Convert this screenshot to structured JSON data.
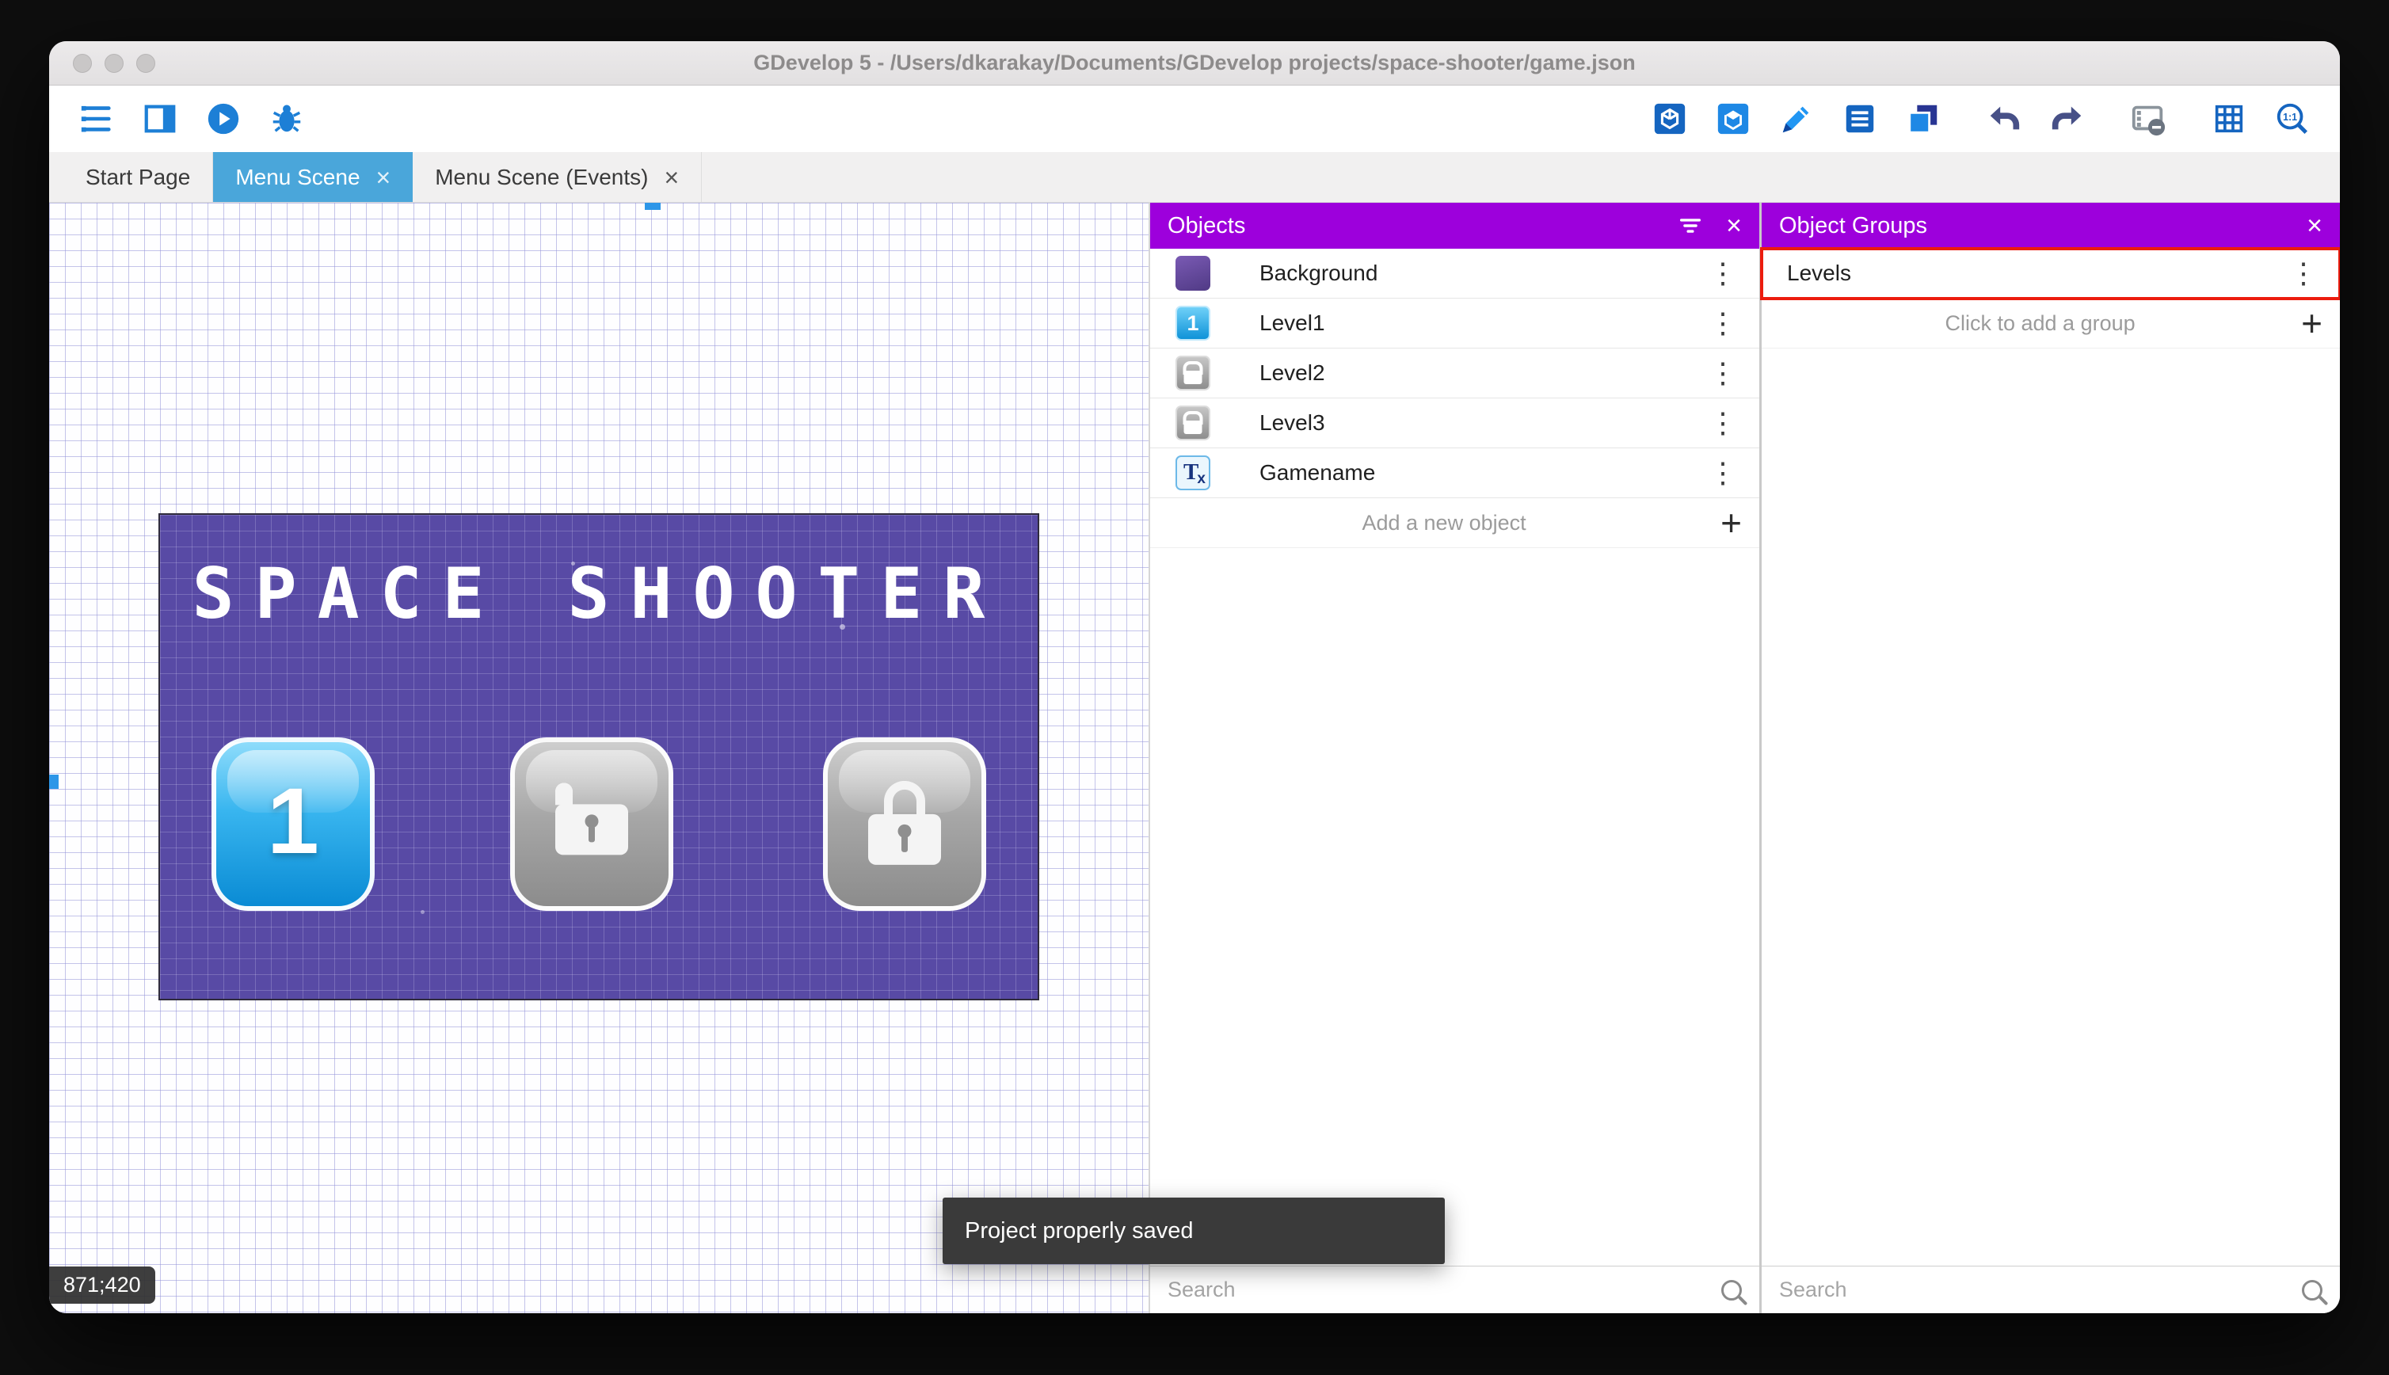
{
  "window": {
    "title": "GDevelop 5 - /Users/dkarakay/Documents/GDevelop projects/space-shooter/game.json"
  },
  "tabs": {
    "start": "Start Page",
    "scene": "Menu Scene",
    "events": "Menu Scene (Events)"
  },
  "glyphs": {
    "dots": "⋮",
    "plus": "+",
    "close": "×"
  },
  "toolbar": {
    "left_icons": [
      "project-manager",
      "scenes",
      "preview",
      "debug"
    ],
    "right_icons": [
      "publish",
      "extensions",
      "edit",
      "instances",
      "layers",
      "undo",
      "redo",
      "mask",
      "grid",
      "zoom"
    ],
    "zoom_label": "1:1",
    "accent_blue": "#1d7fd6",
    "accent_navy": "#27368f"
  },
  "canvas": {
    "coordinates": "871;420",
    "scene": {
      "title": "SPACE SHOOTER",
      "button1_label": "1",
      "background_color": "#584aa5"
    }
  },
  "toast": {
    "message": "Project properly saved"
  },
  "objects_panel": {
    "title": "Objects",
    "header_color": "#9d00dc",
    "items": [
      {
        "name": "Background",
        "icon": "purple-swatch"
      },
      {
        "name": "Level1",
        "icon": "blue-button",
        "badge": "1"
      },
      {
        "name": "Level2",
        "icon": "lock"
      },
      {
        "name": "Level3",
        "icon": "lock"
      },
      {
        "name": "Gamename",
        "icon": "text-object",
        "icon_text": "T",
        "icon_sub": "x"
      }
    ],
    "add_label": "Add a new object",
    "search_placeholder": "Search"
  },
  "groups_panel": {
    "title": "Object Groups",
    "items": [
      {
        "name": "Levels",
        "annotated": true
      }
    ],
    "add_label": "Click to add a group",
    "search_placeholder": "Search",
    "annotation_color": "#ec1c0e"
  }
}
